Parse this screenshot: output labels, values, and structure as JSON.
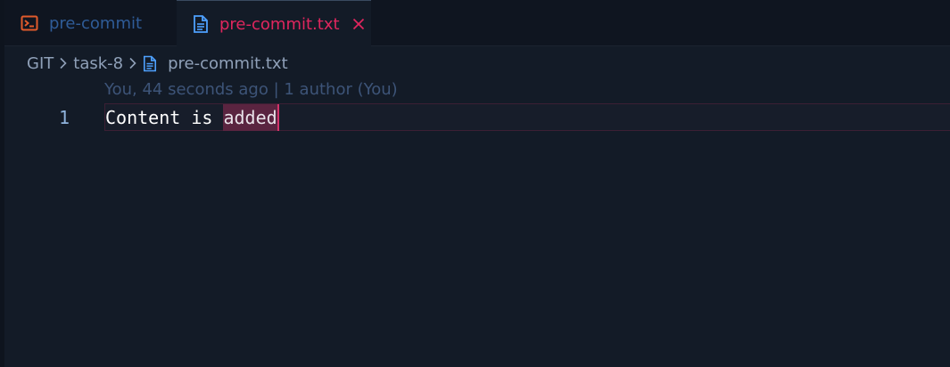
{
  "tabs": [
    {
      "label": "pre-commit",
      "icon": "terminal-icon",
      "active": false
    },
    {
      "label": "pre-commit.txt",
      "icon": "file-icon",
      "active": true
    }
  ],
  "breadcrumb": [
    "GIT",
    "task-8",
    "pre-commit.txt"
  ],
  "blame": "You, 44 seconds ago | 1 author (You)",
  "editor": {
    "line_number": "1",
    "line_prefix": "Content is ",
    "line_highlight": "added"
  },
  "colors": {
    "background": "#131b27",
    "tab_active_text": "#e0265e",
    "tab_inactive_text": "#2f5c98",
    "terminal_icon": "#e05a2b",
    "file_icon": "#4ea1ff",
    "highlight": "#5a2440"
  }
}
